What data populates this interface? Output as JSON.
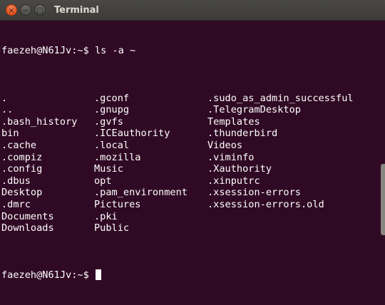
{
  "window": {
    "title": "Terminal",
    "close_glyph": "×",
    "minimize_glyph": "−",
    "maximize_glyph": "□"
  },
  "terminal": {
    "prompt_user_host": "faezeh@N61Jv:~$",
    "command": " ls -a ~",
    "columns": [
      [
        ".",
        "..",
        ".bash_history",
        "bin",
        ".cache",
        ".compiz",
        ".config",
        ".dbus",
        "Desktop",
        ".dmrc",
        "Documents",
        "Downloads"
      ],
      [
        ".gconf",
        ".gnupg",
        ".gvfs",
        ".ICEauthority",
        ".local",
        ".mozilla",
        "Music",
        "opt",
        ".pam_environment",
        "Pictures",
        ".pki",
        "Public"
      ],
      [
        ".sudo_as_admin_successful",
        ".TelegramDesktop",
        "Templates",
        ".thunderbird",
        "Videos",
        ".viminfo",
        ".Xauthority",
        ".xinputrc",
        ".xsession-errors",
        ".xsession-errors.old"
      ]
    ],
    "final_prompt": "faezeh@N61Jv:~$ "
  },
  "colors": {
    "background": "#300a24",
    "text": "#ffffff",
    "titlebar": "#3c3b37",
    "close_button": "#e2501b"
  }
}
